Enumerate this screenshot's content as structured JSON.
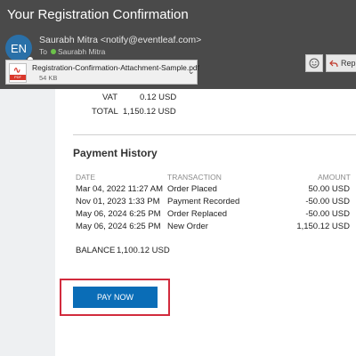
{
  "window": {
    "title": "Your Registration Confirmation"
  },
  "email": {
    "avatar_initials": "EN",
    "sender": "Saurabh Mitra <notify@eventleaf.com>",
    "to_label": "To",
    "to_name": "Saurabh Mitra",
    "toolbar": {
      "emoji_icon": "smiley-icon",
      "reply_label": "Rep"
    }
  },
  "attachment": {
    "filename": "Registration-Confirmation-Attachment-Sample.pdf",
    "size": "54 KB",
    "icon": "pdf-icon"
  },
  "summary": {
    "vat_label": "VAT",
    "vat_value": "0.12 USD",
    "total_label": "TOTAL",
    "total_value": "1,150.12 USD"
  },
  "payment_history": {
    "title": "Payment History",
    "columns": [
      "DATE",
      "TRANSACTION",
      "AMOUNT"
    ],
    "rows": [
      {
        "date": "Mar 04, 2022 11:27 AM",
        "transaction": "Order Placed",
        "amount": "50.00 USD"
      },
      {
        "date": "Nov 01, 2023 1:33 PM",
        "transaction": "Payment Recorded",
        "amount": "-50.00 USD"
      },
      {
        "date": "May 06, 2024 6:25 PM",
        "transaction": "Order Replaced",
        "amount": "-50.00 USD"
      },
      {
        "date": "May 06, 2024 6:25 PM",
        "transaction": "New Order",
        "amount": "1,150.12 USD"
      }
    ],
    "balance_label": "BALANCE",
    "balance_value": "1,100.12 USD"
  },
  "actions": {
    "pay_now_label": "PAY NOW"
  },
  "colors": {
    "header_bg": "#4a4a4a",
    "avatar_bg": "#2a70a8",
    "pay_button": "#0a6db7",
    "highlight_border": "#d22b3d",
    "pdf_red": "#d9372b",
    "presence_green": "#6cc24a"
  }
}
